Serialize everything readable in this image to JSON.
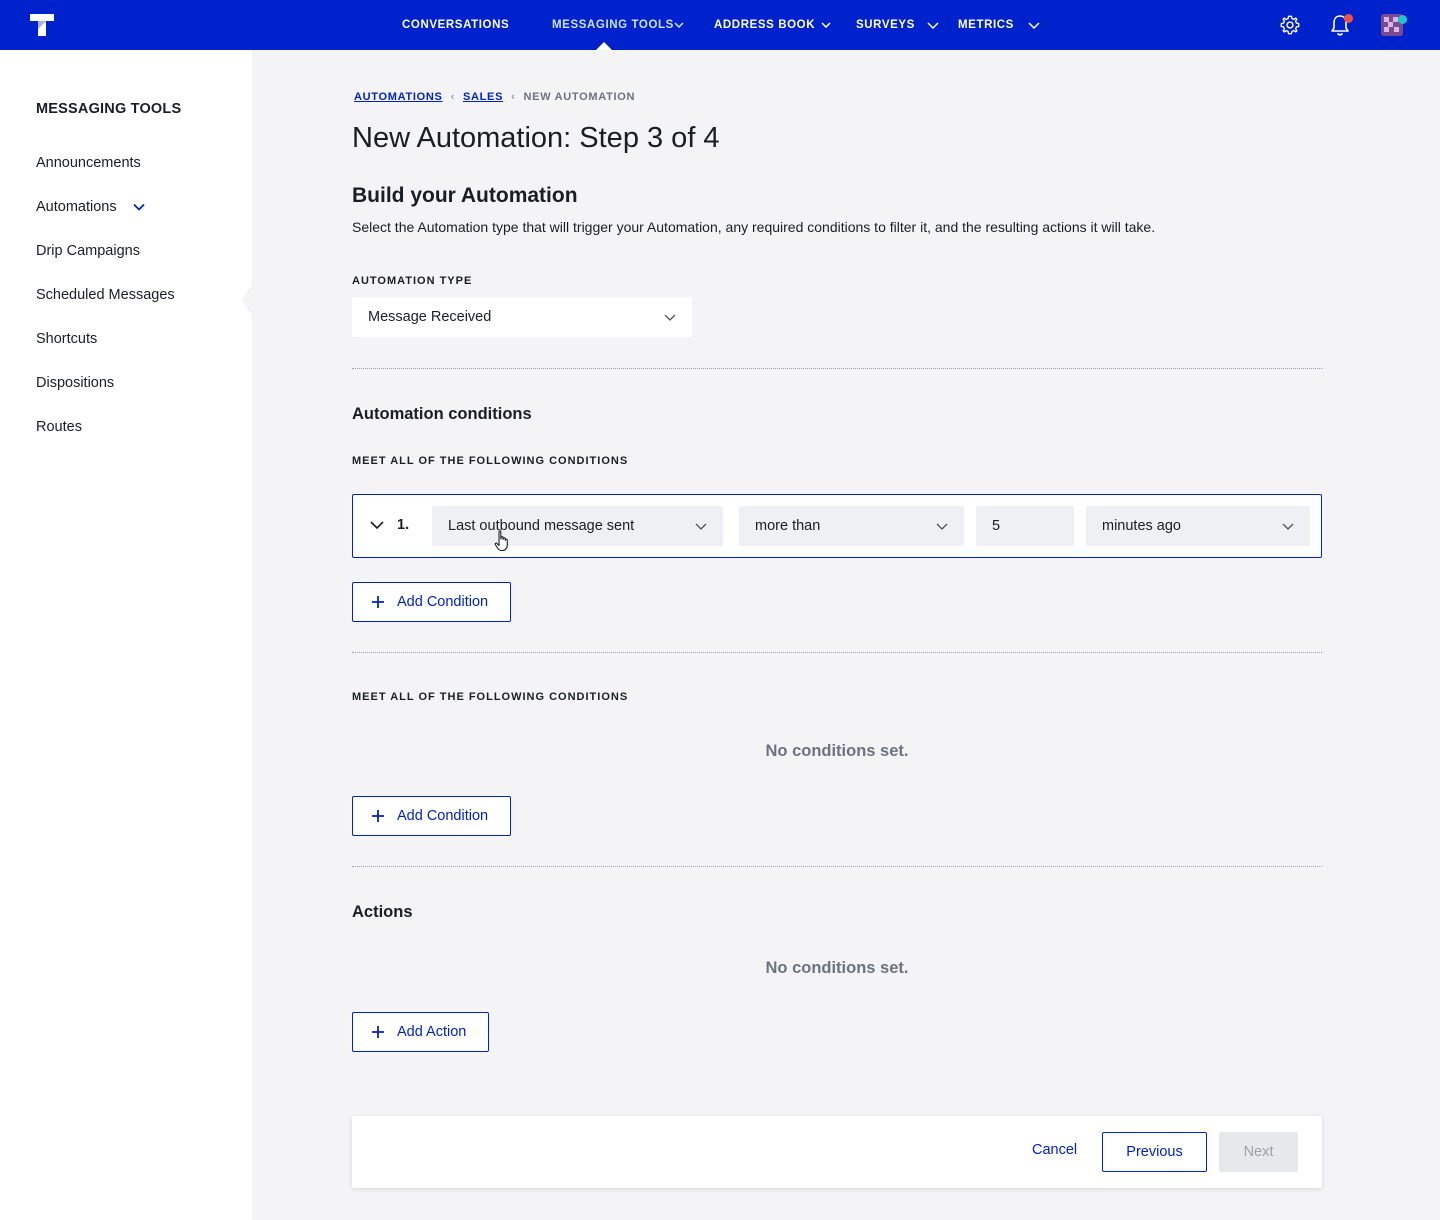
{
  "nav": {
    "items": [
      {
        "label": "CONVERSATIONS"
      },
      {
        "label": "MESSAGING TOOLS"
      },
      {
        "label": "ADDRESS BOOK"
      },
      {
        "label": "SURVEYS"
      },
      {
        "label": "METRICS"
      }
    ],
    "icons": [
      "settings-icon",
      "bell-icon",
      "avatar"
    ],
    "colors": {
      "bar": "#0022cc",
      "notification_dot": "#f0524b",
      "status_dot": "#1fc7c7"
    }
  },
  "sidebar": {
    "title": "MESSAGING TOOLS",
    "items": [
      {
        "label": "Announcements"
      },
      {
        "label": "Automations"
      },
      {
        "label": "Drip Campaigns"
      },
      {
        "label": "Scheduled Messages"
      },
      {
        "label": "Shortcuts"
      },
      {
        "label": "Dispositions"
      },
      {
        "label": "Routes"
      }
    ]
  },
  "breadcrumb": {
    "items": [
      "AUTOMATIONS",
      "SALES"
    ],
    "current": "NEW AUTOMATION"
  },
  "page": {
    "title": "New Automation: Step 3 of 4",
    "section_title": "Build your Automation",
    "section_desc": "Select the Automation type that will trigger your Automation, any required conditions to filter it, and the resulting actions it will take."
  },
  "automation_type": {
    "label": "AUTOMATION TYPE",
    "value": "Message Received"
  },
  "conditions": {
    "heading": "Automation conditions",
    "group1": {
      "label": "MEET ALL OF THE FOLLOWING CONDITIONS",
      "rows": [
        {
          "number": "1.",
          "field": "Last outbound message sent",
          "operator": "more than",
          "value": "5",
          "unit": "minutes ago"
        }
      ],
      "add_label": "Add Condition"
    },
    "group2": {
      "label": "MEET ALL OF THE FOLLOWING CONDITIONS",
      "empty_text": "No conditions set.",
      "add_label": "Add Condition"
    }
  },
  "actions": {
    "heading": "Actions",
    "empty_text": "No conditions set.",
    "add_label": "Add Action"
  },
  "footer": {
    "cancel_label": "Cancel",
    "previous_label": "Previous",
    "next_label": "Next"
  }
}
